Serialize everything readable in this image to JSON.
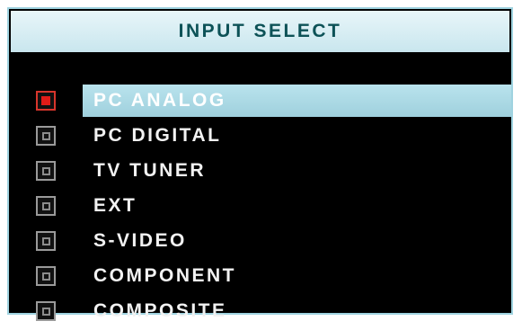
{
  "osd": {
    "title": "INPUT SELECT",
    "items": [
      {
        "label": "PC ANALOG",
        "selected": true
      },
      {
        "label": "PC DIGITAL",
        "selected": false
      },
      {
        "label": "TV TUNER",
        "selected": false
      },
      {
        "label": "EXT",
        "selected": false
      },
      {
        "label": "S-VIDEO",
        "selected": false
      },
      {
        "label": "COMPONENT",
        "selected": false
      },
      {
        "label": "COMPOSITE",
        "selected": false
      }
    ]
  },
  "colors": {
    "background": "#000000",
    "frame": "#9fd3e0",
    "highlight": "#b9e3ed",
    "title_text": "#0d5257",
    "item_text": "#f2f2f2",
    "selected_marker": "#e11c18",
    "unselected_marker": "#9a9a9a"
  }
}
